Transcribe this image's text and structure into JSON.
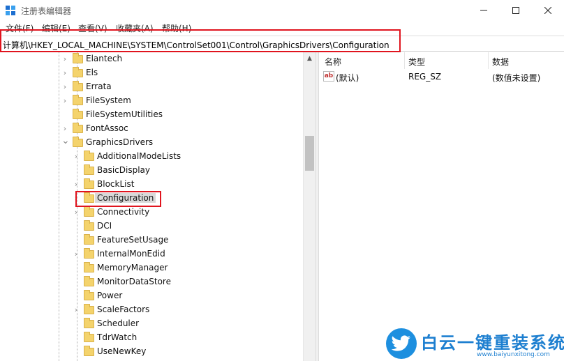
{
  "window": {
    "title": "注册表编辑器"
  },
  "menu": [
    "文件(F)",
    "编辑(E)",
    "查看(V)",
    "收藏夹(A)",
    "帮助(H)"
  ],
  "address": "计算机\\HKEY_LOCAL_MACHINE\\SYSTEM\\ControlSet001\\Control\\GraphicsDrivers\\Configuration",
  "tree": [
    {
      "label": "Elantech",
      "expandable": true
    },
    {
      "label": "Els",
      "expandable": true
    },
    {
      "label": "Errata",
      "expandable": true
    },
    {
      "label": "FileSystem",
      "expandable": true
    },
    {
      "label": "FileSystemUtilities",
      "expandable": false
    },
    {
      "label": "FontAssoc",
      "expandable": true
    },
    {
      "label": "GraphicsDrivers",
      "expandable": true,
      "expanded": true
    },
    {
      "label": "AdditionalModeLists",
      "expandable": true
    },
    {
      "label": "BasicDisplay",
      "expandable": false
    },
    {
      "label": "BlockList",
      "expandable": true
    },
    {
      "label": "Configuration",
      "expandable": true,
      "selected": true
    },
    {
      "label": "Connectivity",
      "expandable": true
    },
    {
      "label": "DCI",
      "expandable": false
    },
    {
      "label": "FeatureSetUsage",
      "expandable": false
    },
    {
      "label": "InternalMonEdid",
      "expandable": true
    },
    {
      "label": "MemoryManager",
      "expandable": false
    },
    {
      "label": "MonitorDataStore",
      "expandable": false
    },
    {
      "label": "Power",
      "expandable": false
    },
    {
      "label": "ScaleFactors",
      "expandable": true
    },
    {
      "label": "Scheduler",
      "expandable": false
    },
    {
      "label": "TdrWatch",
      "expandable": false
    },
    {
      "label": "UseNewKey",
      "expandable": false
    }
  ],
  "columns": {
    "name": "名称",
    "type": "类型",
    "data": "数据"
  },
  "values": [
    {
      "name": "(默认)",
      "type": "REG_SZ",
      "data": "(数值未设置)"
    }
  ],
  "watermark": {
    "text": "白云一键重装系统",
    "url": "www.baiyunxitong.com"
  },
  "colors": {
    "highlight_box": "#e0141e",
    "folder": "#f4d36c",
    "watermark": "#1d7fd0"
  }
}
